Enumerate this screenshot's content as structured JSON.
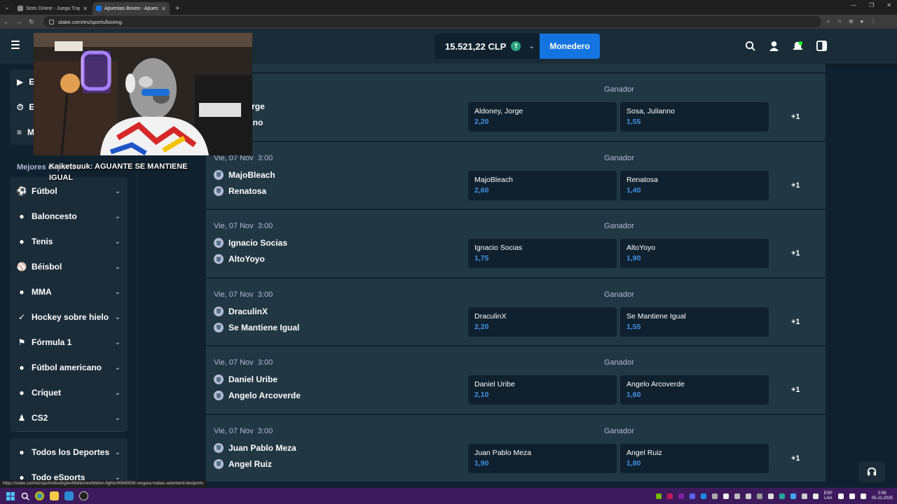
{
  "browser": {
    "tabs": [
      {
        "title": "Slots Online - Juega Tragam",
        "active": false
      },
      {
        "title": "Apuestas Boxeo - Apuesta en",
        "active": true
      }
    ],
    "url": "stake.com/es/sports/boxing",
    "status_url": "https://stake.com/es/sports/boxing/exhibition/exhibition-fights/45940506-vergara-matias-aniemerdi-benjamin"
  },
  "header": {
    "balance": "15.521,22 CLP",
    "coin_symbol": "T",
    "wallet_label": "Monedero"
  },
  "sidebar": {
    "section_label": "Mejores deportes",
    "top_items": [
      "E",
      "E",
      "M"
    ],
    "sports": [
      {
        "label": "Fútbol",
        "icon": "soccer-ball-icon"
      },
      {
        "label": "Baloncesto",
        "icon": "basketball-icon"
      },
      {
        "label": "Tenis",
        "icon": "tennis-ball-icon"
      },
      {
        "label": "Béisbol",
        "icon": "baseball-icon"
      },
      {
        "label": "MMA",
        "icon": "mma-icon"
      },
      {
        "label": "Hockey sobre hielo",
        "icon": "hockey-stick-icon"
      },
      {
        "label": "Fórmula 1",
        "icon": "racing-icon"
      },
      {
        "label": "Fútbol americano",
        "icon": "american-football-icon"
      },
      {
        "label": "Críquet",
        "icon": "cricket-icon"
      },
      {
        "label": "CS2",
        "icon": "esports-runner-icon"
      }
    ],
    "bottom_items": [
      {
        "label": "Todos los Deportes",
        "icon": "all-sports-icon"
      },
      {
        "label": "Todo eSports",
        "icon": "esports-icon"
      }
    ]
  },
  "events": [
    {
      "date": "",
      "time": "3:00",
      "market": "Ganador",
      "team1": "ey, Jorge",
      "team2": "Julianno",
      "odds": [
        {
          "name": "Aldoney, Jorge",
          "price": "2,20"
        },
        {
          "name": "Sosa, Julianno",
          "price": "1,55"
        }
      ],
      "more": "+1"
    },
    {
      "date": "Vie, 07 Nov",
      "time": "3:00",
      "market": "Ganador",
      "team1": "MajoBleach",
      "team2": "Renatosa",
      "odds": [
        {
          "name": "MajoBleach",
          "price": "2,60"
        },
        {
          "name": "Renatosa",
          "price": "1,40"
        }
      ],
      "more": "+1"
    },
    {
      "date": "Vie, 07 Nov",
      "time": "3:00",
      "market": "Ganador",
      "team1": "Ignacio Socias",
      "team2": "AltoYoyo",
      "odds": [
        {
          "name": "Ignacio Socias",
          "price": "1,75"
        },
        {
          "name": "AltoYoyo",
          "price": "1,90"
        }
      ],
      "more": "+1"
    },
    {
      "date": "Vie, 07 Nov",
      "time": "3:00",
      "market": "Ganador",
      "team1": "DraculinX",
      "team2": "Se Mantiene Igual",
      "odds": [
        {
          "name": "DraculinX",
          "price": "2,20"
        },
        {
          "name": "Se Mantiene Igual",
          "price": "1,55"
        }
      ],
      "more": "+1"
    },
    {
      "date": "Vie, 07 Nov",
      "time": "3:00",
      "market": "Ganador",
      "team1": "Daniel Uribe",
      "team2": "Angelo Arcoverde",
      "odds": [
        {
          "name": "Daniel Uribe",
          "price": "2,10"
        },
        {
          "name": "Angelo Arcoverde",
          "price": "1,60"
        }
      ],
      "more": "+1"
    },
    {
      "date": "Vie, 07 Nov",
      "time": "3:00",
      "market": "Ganador",
      "team1": "Juan Pablo Meza",
      "team2": "Angel Ruiz",
      "odds": [
        {
          "name": "Juan Pablo Meza",
          "price": "1,90"
        },
        {
          "name": "Angel Ruiz",
          "price": "1,80"
        }
      ],
      "more": "+1"
    }
  ],
  "webcam": {
    "caption": "Kaiketsuuk: AGUANTE SE MANTIENE IGUAL"
  },
  "taskbar": {
    "lang": "ESP\nLAA",
    "time": "0:56",
    "date": "05-11-2025"
  },
  "colors": {
    "bg": "#0f212e",
    "panel": "#213743",
    "header": "#1a2c38",
    "accent": "#1475e1",
    "odds_price": "#4391e7",
    "taskbar": "#3d1a5c"
  }
}
